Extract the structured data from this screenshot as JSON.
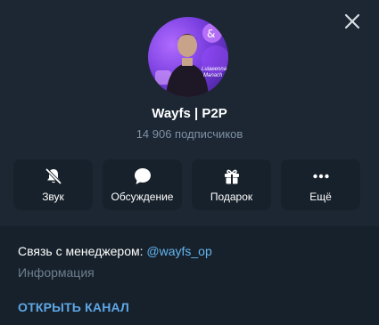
{
  "header": {
    "close_icon": "close-icon"
  },
  "channel": {
    "name": "Wayfs | P2P",
    "subscribers": "14 906 подписчиков",
    "avatar_text_1": "Luiaeenna",
    "avatar_text_2": "Manach"
  },
  "actions": [
    {
      "label": "Звук",
      "icon": "bell-muted-icon"
    },
    {
      "label": "Обсуждение",
      "icon": "chat-bubble-icon"
    },
    {
      "label": "Подарок",
      "icon": "gift-icon"
    },
    {
      "label": "Ещё",
      "icon": "more-dots-icon"
    }
  ],
  "info": {
    "contact_prefix": "Связь с менеджером: ",
    "contact_link": "@wayfs_op",
    "label": "Информация"
  },
  "open_button": "ОТКРЫТЬ КАНАЛ",
  "colors": {
    "background": "#1c2733",
    "panel": "#17212b",
    "accent": "#5ea7e6",
    "muted_text": "#7f91a4"
  }
}
